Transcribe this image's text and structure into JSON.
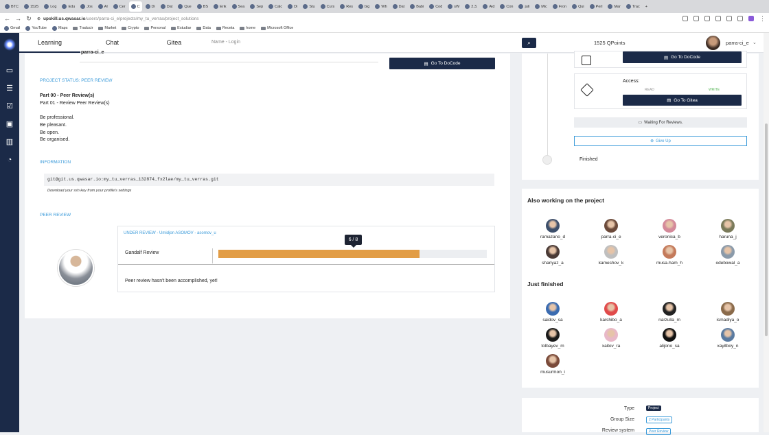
{
  "browser": {
    "tabs": [
      "BTC",
      "1525",
      "Log",
      "Edu",
      "Jos",
      "Al",
      "Cer",
      "C",
      "Di",
      "Dat",
      "Que",
      "BS",
      "Erik",
      "Sea",
      "Sep",
      "Calc",
      "Di",
      "Stu",
      "Curs",
      "Res",
      "big",
      "Wh",
      "Dat",
      "Babi",
      "Cod",
      "sW",
      "2.3.",
      "Aid",
      "Con",
      "juli",
      "Mic",
      "Fron",
      "Qui",
      "Perl",
      "Mar",
      "Trac"
    ],
    "url_domain": "upskill.us.qwasar.io",
    "url_path": "/users/parra-ci_e/projects/my_tu_verras/project_solutions",
    "bookmarks": [
      "Gmail",
      "YouTube",
      "Maps",
      "Traducir",
      "Market",
      "Crypto",
      "Personal",
      "Estudiar",
      "Data",
      "Receta",
      "home",
      "Microsoft Office"
    ]
  },
  "nav": {
    "learning": "Learning",
    "chat": "Chat",
    "gitea": "Gitea",
    "name_login": "Name - Login",
    "qpoints": "1525 QPoints",
    "username": "parra-ci_e"
  },
  "main": {
    "top_name": "parra-ci_e",
    "docode_button": "Go To DoCode",
    "project_status": "PROJECT STATUS: PEER REVIEW",
    "part00": "Part 00 - Peer Review(s)",
    "part01": "Part 01 - Review Peer Review(s)",
    "rules": [
      "Be professional.",
      "Be pleasant.",
      "Be open.",
      "Be organised."
    ],
    "information_head": "INFORMATION",
    "git_url": "git@git.us.qwasar.io:my_tu_verras_132874_fx2lae/my_tu_verras.git",
    "ssh_note": "Download your ssh key from your profile's settings",
    "peer_review_head": "PEER REVIEW",
    "under_review": "UNDER REVIEW - Umidjon ASOMOV - asomov_u",
    "review_name": "Gandalf Review",
    "progress_label": "6 / 8",
    "progress_value": 0.75,
    "not_accomplished": "Peer review hasn't been accomplished, yet!"
  },
  "right": {
    "docode_button": "Go To DoCode",
    "access_label": "Access:",
    "read": "READ",
    "write": "WRITE",
    "gitea_button": "Go To Gitea",
    "waiting": "Waiting For Reviews.",
    "give_up": "Give Up",
    "finished": "Finished"
  },
  "working": {
    "title": "Also working on the project",
    "people": [
      "ramazano_d",
      "parra-ci_e",
      "veronica_b",
      "haruna_j",
      "shariyaz_a",
      "kameshov_k",
      "musa-ham_h",
      "odebowal_a"
    ],
    "colors": [
      "#3d4f6b",
      "#6b4a3a",
      "#d48a9a",
      "#7a7a5a",
      "#4a3a35",
      "#bfbfbf",
      "#c47a5a",
      "#8a9aaa"
    ]
  },
  "finished": {
    "title": "Just finished",
    "people": [
      "saidov_sa",
      "karshibo_a",
      "narzulla_m",
      "ismadiya_o",
      "tolbayev_m",
      "xaitov_ra",
      "alijono_sa",
      "xayitboy_n",
      "musurmon_i"
    ],
    "colors": [
      "#3a6bb0",
      "#e04a4a",
      "#222222",
      "#8a6a4a",
      "#1a1a1a",
      "#e8b8c8",
      "#111111",
      "#5a7aa0",
      "#7a4a3a"
    ]
  },
  "info": {
    "type_label": "Type",
    "type_value": "Project",
    "group_label": "Group Size",
    "group_value": "2 Participants",
    "review_label": "Review system",
    "review_value": "Peer Review"
  }
}
